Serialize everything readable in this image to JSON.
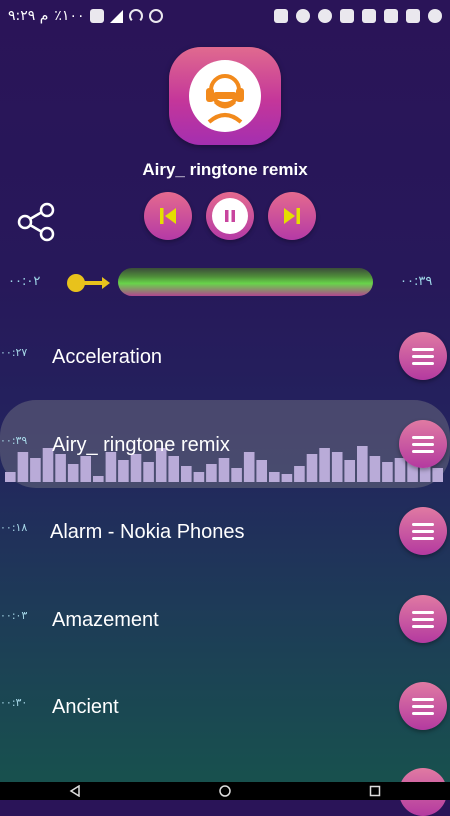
{
  "status_bar": {
    "time": "۹:۲۹ م",
    "battery": "٪۱۰۰"
  },
  "player": {
    "current_title": "Airy_ ringtone remix",
    "elapsed": "۰۰:۰۲",
    "remaining": "۰۰:۳۹",
    "progress_fraction": 0.05
  },
  "tracks": [
    {
      "name": "Acceleration",
      "duration": "۰۰:۲۷"
    },
    {
      "name": "Airy_ ringtone remix",
      "duration": "۰۰:۳۹"
    },
    {
      "name": "Alarm  - Nokia Phones",
      "duration": "۰۰:۱۸"
    },
    {
      "name": "Amazement",
      "duration": "۰۰:۰۳"
    },
    {
      "name": "Ancient",
      "duration": "۰۰:۳۰"
    }
  ],
  "icons": {
    "share": "share-icon",
    "prev": "skip-previous-icon",
    "pause": "pause-icon",
    "next": "skip-next-icon",
    "menu": "hamburger-menu-icon"
  },
  "colors": {
    "accent_yellow": "#e4e000",
    "button_pink": "#c8449e"
  }
}
